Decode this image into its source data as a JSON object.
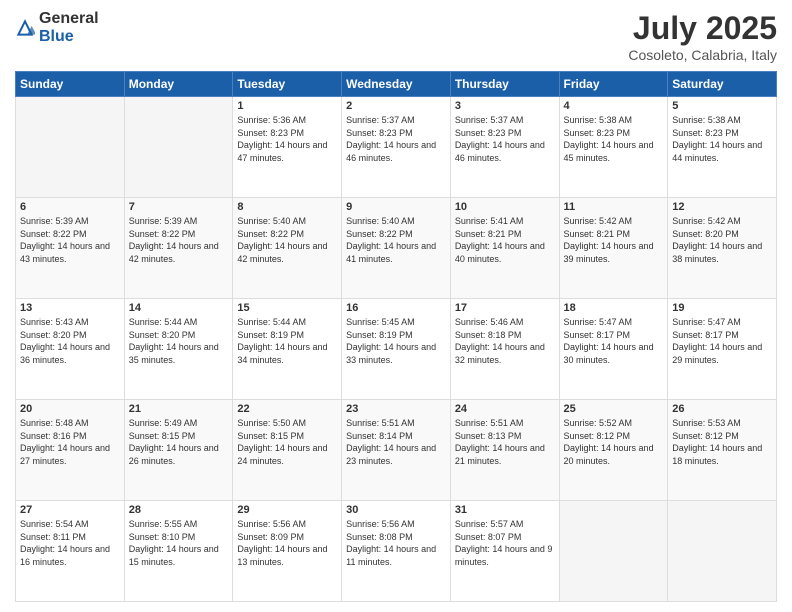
{
  "header": {
    "logo_general": "General",
    "logo_blue": "Blue",
    "main_title": "July 2025",
    "subtitle": "Cosoleto, Calabria, Italy"
  },
  "days_of_week": [
    "Sunday",
    "Monday",
    "Tuesday",
    "Wednesday",
    "Thursday",
    "Friday",
    "Saturday"
  ],
  "weeks": [
    [
      {
        "day": "",
        "info": ""
      },
      {
        "day": "",
        "info": ""
      },
      {
        "day": "1",
        "info": "Sunrise: 5:36 AM\nSunset: 8:23 PM\nDaylight: 14 hours and 47 minutes."
      },
      {
        "day": "2",
        "info": "Sunrise: 5:37 AM\nSunset: 8:23 PM\nDaylight: 14 hours and 46 minutes."
      },
      {
        "day": "3",
        "info": "Sunrise: 5:37 AM\nSunset: 8:23 PM\nDaylight: 14 hours and 46 minutes."
      },
      {
        "day": "4",
        "info": "Sunrise: 5:38 AM\nSunset: 8:23 PM\nDaylight: 14 hours and 45 minutes."
      },
      {
        "day": "5",
        "info": "Sunrise: 5:38 AM\nSunset: 8:23 PM\nDaylight: 14 hours and 44 minutes."
      }
    ],
    [
      {
        "day": "6",
        "info": "Sunrise: 5:39 AM\nSunset: 8:22 PM\nDaylight: 14 hours and 43 minutes."
      },
      {
        "day": "7",
        "info": "Sunrise: 5:39 AM\nSunset: 8:22 PM\nDaylight: 14 hours and 42 minutes."
      },
      {
        "day": "8",
        "info": "Sunrise: 5:40 AM\nSunset: 8:22 PM\nDaylight: 14 hours and 42 minutes."
      },
      {
        "day": "9",
        "info": "Sunrise: 5:40 AM\nSunset: 8:22 PM\nDaylight: 14 hours and 41 minutes."
      },
      {
        "day": "10",
        "info": "Sunrise: 5:41 AM\nSunset: 8:21 PM\nDaylight: 14 hours and 40 minutes."
      },
      {
        "day": "11",
        "info": "Sunrise: 5:42 AM\nSunset: 8:21 PM\nDaylight: 14 hours and 39 minutes."
      },
      {
        "day": "12",
        "info": "Sunrise: 5:42 AM\nSunset: 8:20 PM\nDaylight: 14 hours and 38 minutes."
      }
    ],
    [
      {
        "day": "13",
        "info": "Sunrise: 5:43 AM\nSunset: 8:20 PM\nDaylight: 14 hours and 36 minutes."
      },
      {
        "day": "14",
        "info": "Sunrise: 5:44 AM\nSunset: 8:20 PM\nDaylight: 14 hours and 35 minutes."
      },
      {
        "day": "15",
        "info": "Sunrise: 5:44 AM\nSunset: 8:19 PM\nDaylight: 14 hours and 34 minutes."
      },
      {
        "day": "16",
        "info": "Sunrise: 5:45 AM\nSunset: 8:19 PM\nDaylight: 14 hours and 33 minutes."
      },
      {
        "day": "17",
        "info": "Sunrise: 5:46 AM\nSunset: 8:18 PM\nDaylight: 14 hours and 32 minutes."
      },
      {
        "day": "18",
        "info": "Sunrise: 5:47 AM\nSunset: 8:17 PM\nDaylight: 14 hours and 30 minutes."
      },
      {
        "day": "19",
        "info": "Sunrise: 5:47 AM\nSunset: 8:17 PM\nDaylight: 14 hours and 29 minutes."
      }
    ],
    [
      {
        "day": "20",
        "info": "Sunrise: 5:48 AM\nSunset: 8:16 PM\nDaylight: 14 hours and 27 minutes."
      },
      {
        "day": "21",
        "info": "Sunrise: 5:49 AM\nSunset: 8:15 PM\nDaylight: 14 hours and 26 minutes."
      },
      {
        "day": "22",
        "info": "Sunrise: 5:50 AM\nSunset: 8:15 PM\nDaylight: 14 hours and 24 minutes."
      },
      {
        "day": "23",
        "info": "Sunrise: 5:51 AM\nSunset: 8:14 PM\nDaylight: 14 hours and 23 minutes."
      },
      {
        "day": "24",
        "info": "Sunrise: 5:51 AM\nSunset: 8:13 PM\nDaylight: 14 hours and 21 minutes."
      },
      {
        "day": "25",
        "info": "Sunrise: 5:52 AM\nSunset: 8:12 PM\nDaylight: 14 hours and 20 minutes."
      },
      {
        "day": "26",
        "info": "Sunrise: 5:53 AM\nSunset: 8:12 PM\nDaylight: 14 hours and 18 minutes."
      }
    ],
    [
      {
        "day": "27",
        "info": "Sunrise: 5:54 AM\nSunset: 8:11 PM\nDaylight: 14 hours and 16 minutes."
      },
      {
        "day": "28",
        "info": "Sunrise: 5:55 AM\nSunset: 8:10 PM\nDaylight: 14 hours and 15 minutes."
      },
      {
        "day": "29",
        "info": "Sunrise: 5:56 AM\nSunset: 8:09 PM\nDaylight: 14 hours and 13 minutes."
      },
      {
        "day": "30",
        "info": "Sunrise: 5:56 AM\nSunset: 8:08 PM\nDaylight: 14 hours and 11 minutes."
      },
      {
        "day": "31",
        "info": "Sunrise: 5:57 AM\nSunset: 8:07 PM\nDaylight: 14 hours and 9 minutes."
      },
      {
        "day": "",
        "info": ""
      },
      {
        "day": "",
        "info": ""
      }
    ]
  ]
}
